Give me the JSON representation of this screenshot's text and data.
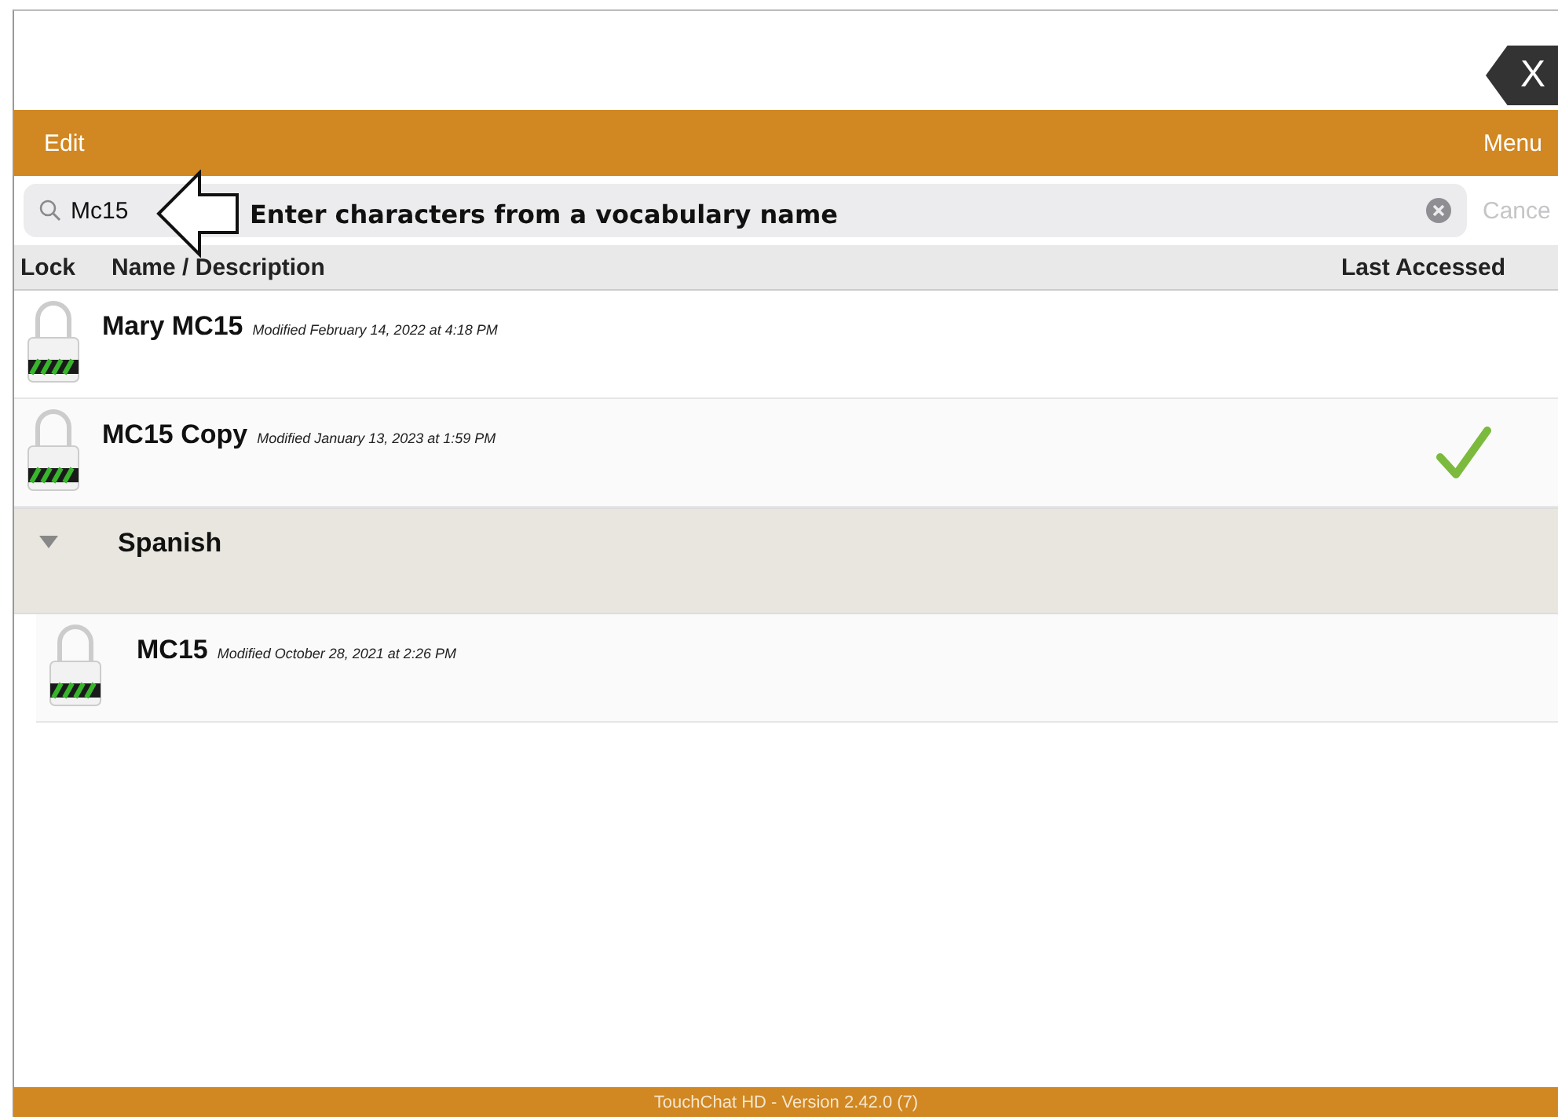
{
  "close_button": {
    "label": "X"
  },
  "toolbar": {
    "left": "Edit",
    "right": "Menu"
  },
  "search": {
    "value": "Mc15",
    "cancel": "Cance"
  },
  "annotation": {
    "text": "Enter characters from a vocabulary name"
  },
  "columns": [
    "Lock",
    "Name / Description",
    "Last Accessed"
  ],
  "items": [
    {
      "kind": "vocab",
      "name": "Mary MC15",
      "modified": "Modified February 14, 2022 at 4:18 PM",
      "last_accessed": false
    },
    {
      "kind": "vocab",
      "name": "MC15 Copy",
      "modified": "Modified January 13, 2023 at 1:59 PM",
      "last_accessed": true
    },
    {
      "kind": "group",
      "name": "Spanish",
      "expanded": true,
      "children": [
        {
          "kind": "vocab",
          "name": "MC15",
          "modified": "Modified October 28, 2021 at 2:26 PM",
          "last_accessed": false
        }
      ]
    }
  ],
  "footer": "TouchChat HD - Version 2.42.0 (7)"
}
